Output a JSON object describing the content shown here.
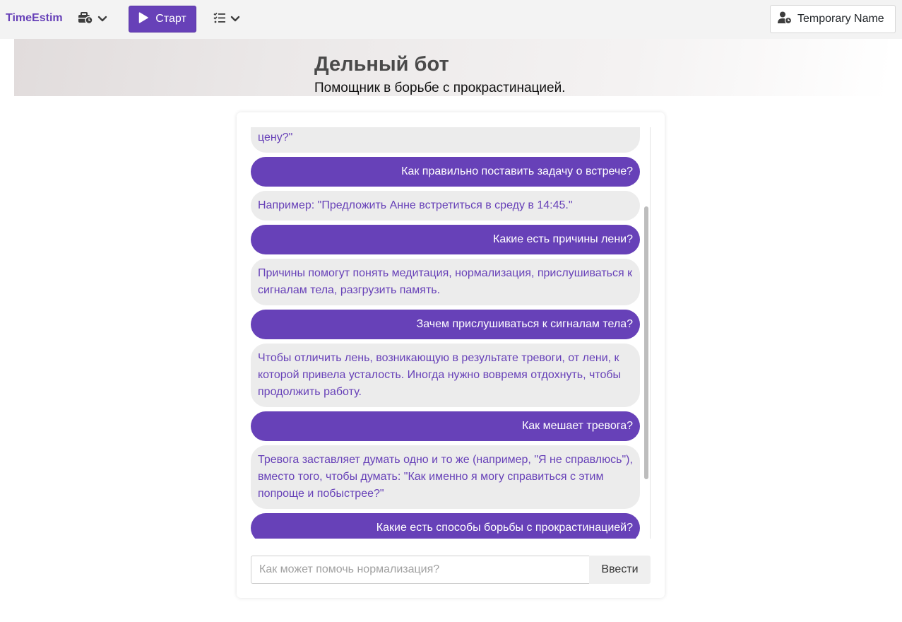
{
  "navbar": {
    "brand": "TimeEstim",
    "tools_icon": "toolbox-clock-icon",
    "start_label": "Старт",
    "tasks_icon": "list-check-icon",
    "user_name": "Temporary Name",
    "colors": {
      "accent": "#6741b8",
      "navbar_bg": "#f3f3f3"
    }
  },
  "banner": {
    "title": "Дельный бот",
    "subtitle": "Помощник в борьбе с прокрастинацией."
  },
  "chat": {
    "messages": [
      {
        "role": "bot",
        "text": "Закрыть глаза и спросить себя \"нужно ли это мне сейчас за такую цену?\""
      },
      {
        "role": "user",
        "text": "Как правильно поставить задачу о встрече?"
      },
      {
        "role": "bot",
        "text": "Например: \"Предложить Анне встретиться в среду в 14:45.\""
      },
      {
        "role": "user",
        "text": "Какие есть причины лени?"
      },
      {
        "role": "bot",
        "text": "Причины помогут понять медитация, нормализация, прислушиваться к сигналам тела, разгрузить память."
      },
      {
        "role": "user",
        "text": "Зачем прислушиваться к сигналам тела?"
      },
      {
        "role": "bot",
        "text": "Чтобы отличить лень, возникающую в результате тревоги, от лени, к которой привела усталость. Иногда нужно вовремя отдохнуть, чтобы продолжить работу."
      },
      {
        "role": "user",
        "text": "Как мешает тревога?"
      },
      {
        "role": "bot",
        "text": "Тревога заставляет думать одно и то же (например, \"Я не справлюсь\"), вместо того, чтобы думать: \"Как именно я могу справиться с этим попроще и побыстрее?\""
      },
      {
        "role": "user",
        "text": "Какие есть способы борьбы с прокрастинацией?"
      }
    ],
    "input_placeholder": "Как может помочь нормализация?",
    "input_value": "",
    "send_label": "Ввести"
  }
}
